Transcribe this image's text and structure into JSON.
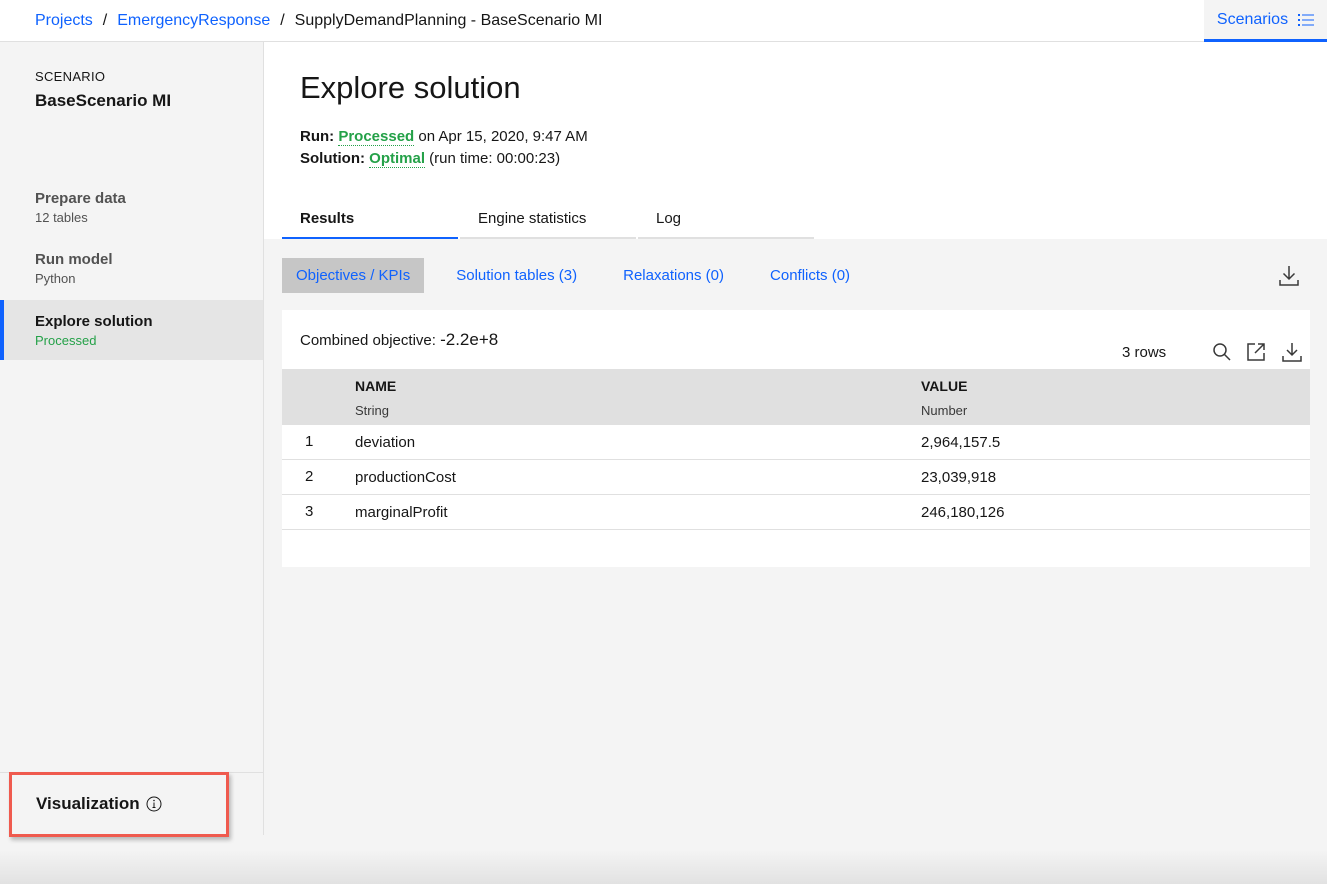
{
  "breadcrumb": {
    "items": [
      "Projects",
      "EmergencyResponse"
    ],
    "separator": "/",
    "current": "SupplyDemandPlanning - BaseScenario MI"
  },
  "header": {
    "scenarios_label": "Scenarios",
    "scenarios_icon": "list-icon"
  },
  "sidebar": {
    "scenario_kicker": "SCENARIO",
    "scenario_name": "BaseScenario MI",
    "items": [
      {
        "label": "Prepare data",
        "sub": "12 tables"
      },
      {
        "label": "Run model",
        "sub": "Python"
      },
      {
        "label": "Explore solution",
        "sub": "Processed"
      }
    ],
    "visualization_label": "Visualization",
    "visualization_icon": "info-icon"
  },
  "main": {
    "title": "Explore solution",
    "run": {
      "label": "Run:",
      "status": "Processed",
      "suffix": "on Apr 15, 2020, 9:47 AM"
    },
    "solution": {
      "label": "Solution:",
      "status": "Optimal",
      "suffix": "(run time: 00:00:23)"
    },
    "tabs": [
      "Results",
      "Engine statistics",
      "Log"
    ],
    "subtabs": [
      "Objectives / KPIs",
      "Solution tables (3)",
      "Relaxations (0)",
      "Conflicts (0)"
    ],
    "combined_label": "Combined objective:",
    "combined_value": "-2.2e+8",
    "row_count": "3 rows",
    "table": {
      "columns": [
        {
          "name": "NAME",
          "type": "String"
        },
        {
          "name": "VALUE",
          "type": "Number"
        }
      ],
      "rows": [
        {
          "index": "1",
          "name": "deviation",
          "value": "2,964,157.5"
        },
        {
          "index": "2",
          "name": "productionCost",
          "value": "23,039,918"
        },
        {
          "index": "3",
          "name": "marginalProfit",
          "value": "246,180,126"
        }
      ]
    }
  },
  "colors": {
    "accent": "#0f62fe",
    "success": "#24a148",
    "highlight": "#ef5a4e"
  }
}
